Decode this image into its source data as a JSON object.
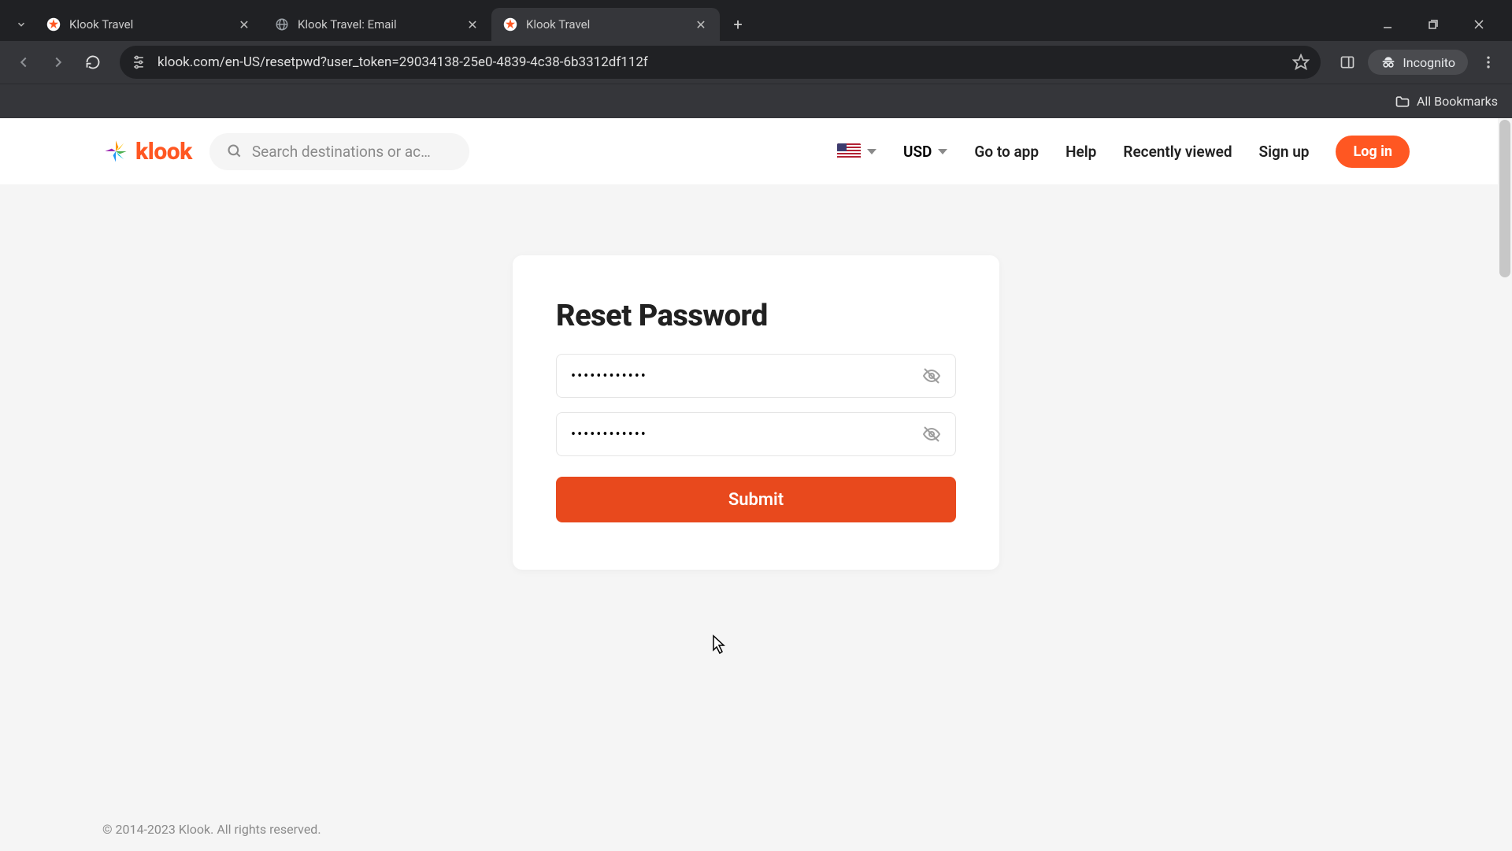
{
  "browser": {
    "tabs": [
      {
        "title": "Klook Travel",
        "favicon": "klook",
        "active": false
      },
      {
        "title": "Klook Travel: Email",
        "favicon": "globe",
        "active": false
      },
      {
        "title": "Klook Travel",
        "favicon": "klook",
        "active": true
      }
    ],
    "url": "klook.com/en-US/resetpwd?user_token=29034138-25e0-4839-4c38-6b3312df112f",
    "incognito_label": "Incognito",
    "bookmarks_label": "All Bookmarks"
  },
  "header": {
    "brand": "klook",
    "search_placeholder": "Search destinations or ac…",
    "currency": "USD",
    "go_to_app": "Go to app",
    "help": "Help",
    "recently_viewed": "Recently viewed",
    "sign_up": "Sign up",
    "log_in": "Log in"
  },
  "card": {
    "title": "Reset Password",
    "password1_value": "••••••••••••",
    "password2_value": "••••••••••••",
    "submit_label": "Submit"
  },
  "footer": {
    "copyright": "© 2014-2023 Klook. All rights reserved."
  }
}
